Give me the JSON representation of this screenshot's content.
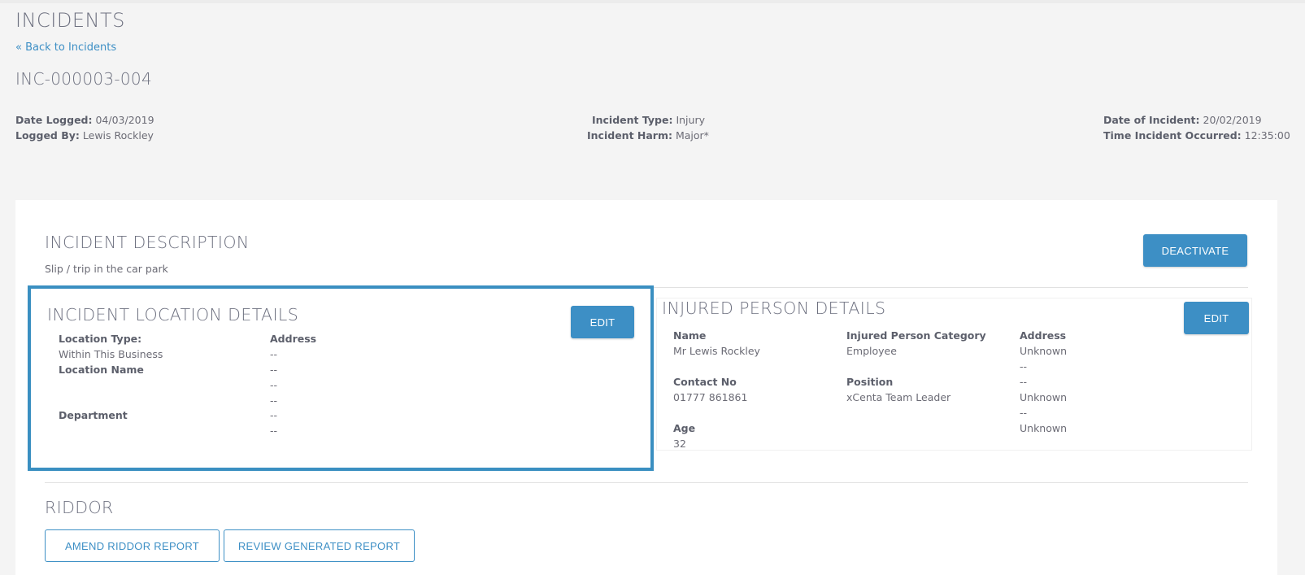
{
  "header": {
    "title": "INCIDENTS",
    "back_link": "« Back to Incidents",
    "incident_id": "INC-000003-004"
  },
  "meta": {
    "date_logged_label": "Date Logged:",
    "date_logged": "04/03/2019",
    "logged_by_label": "Logged By:",
    "logged_by": "Lewis Rockley",
    "incident_type_label": "Incident Type:",
    "incident_type": "Injury",
    "incident_harm_label": "Incident Harm:",
    "incident_harm": "Major*",
    "date_of_incident_label": "Date of Incident:",
    "date_of_incident": "20/02/2019",
    "time_occurred_label": "Time Incident Occurred:",
    "time_occurred": "12:35:00"
  },
  "description": {
    "title": "INCIDENT DESCRIPTION",
    "text": "Slip / trip in the car park",
    "deactivate_label": "DEACTIVATE"
  },
  "location": {
    "title": "INCIDENT LOCATION DETAILS",
    "edit_label": "EDIT",
    "location_type_label": "Location Type:",
    "location_type": "Within This Business",
    "location_name_label": "Location Name",
    "department_label": "Department",
    "address_label": "Address",
    "address_lines": [
      "--",
      "--",
      "--",
      "--",
      "--",
      "--"
    ]
  },
  "injured": {
    "title": "INJURED PERSON DETAILS",
    "edit_label": "EDIT",
    "name_label": "Name",
    "name": "Mr Lewis Rockley",
    "contact_label": "Contact No",
    "contact": "01777 861861",
    "age_label": "Age",
    "age": "32",
    "category_label": "Injured Person Category",
    "category": "Employee",
    "position_label": "Position",
    "position": "xCenta Team Leader",
    "address_label": "Address",
    "address_lines": [
      "Unknown",
      "--",
      "--",
      "Unknown",
      "--",
      "Unknown"
    ]
  },
  "riddor": {
    "title": "RIDDOR",
    "amend_label": "AMEND RIDDOR REPORT",
    "review_label": "REVIEW GENERATED REPORT"
  },
  "colors": {
    "accent": "#3d8fc5",
    "highlight_border": "#3a8fc1",
    "background": "#f4f4f4"
  }
}
